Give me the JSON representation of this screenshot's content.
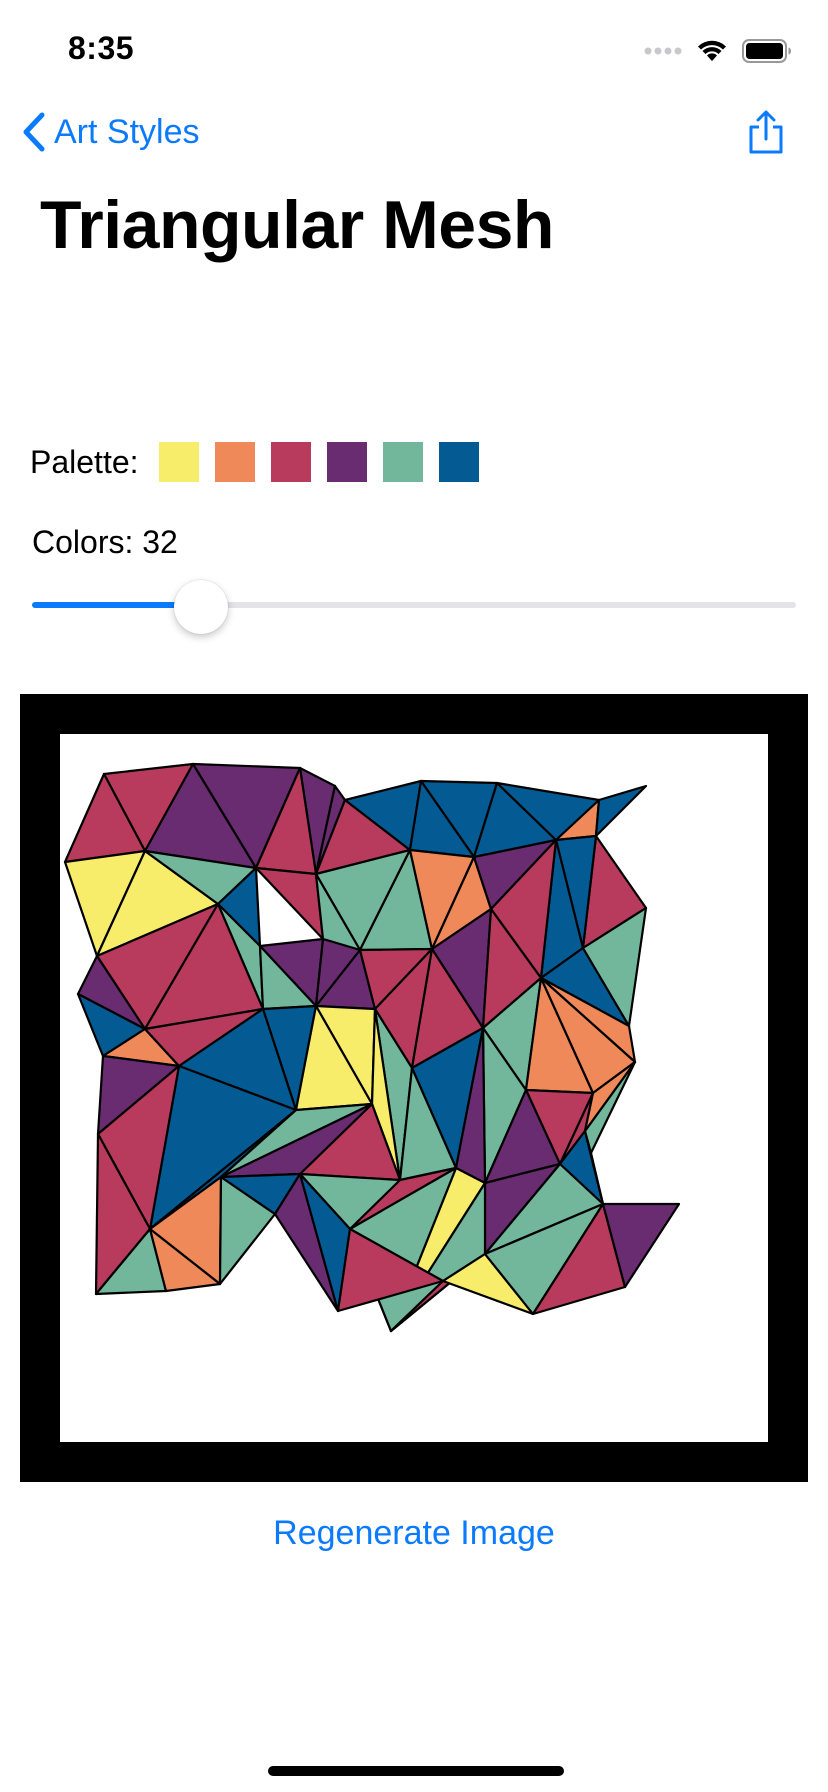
{
  "status_bar": {
    "time": "8:35"
  },
  "nav": {
    "back_label": "Art Styles",
    "title": "Triangular Mesh"
  },
  "palette": {
    "label": "Palette:",
    "colors": [
      "#f8ec6b",
      "#f0895a",
      "#b83b5e",
      "#6a2c70",
      "#72b69c",
      "#045a93"
    ]
  },
  "colors_setting": {
    "label": "Colors: 32",
    "value_fraction": 0.2
  },
  "artwork": {
    "stroke_color": "#000000",
    "frame_color": "#000000"
  },
  "actions": {
    "regenerate_label": "Regenerate Image"
  },
  "theme": {
    "accent": "#0a7aff"
  }
}
